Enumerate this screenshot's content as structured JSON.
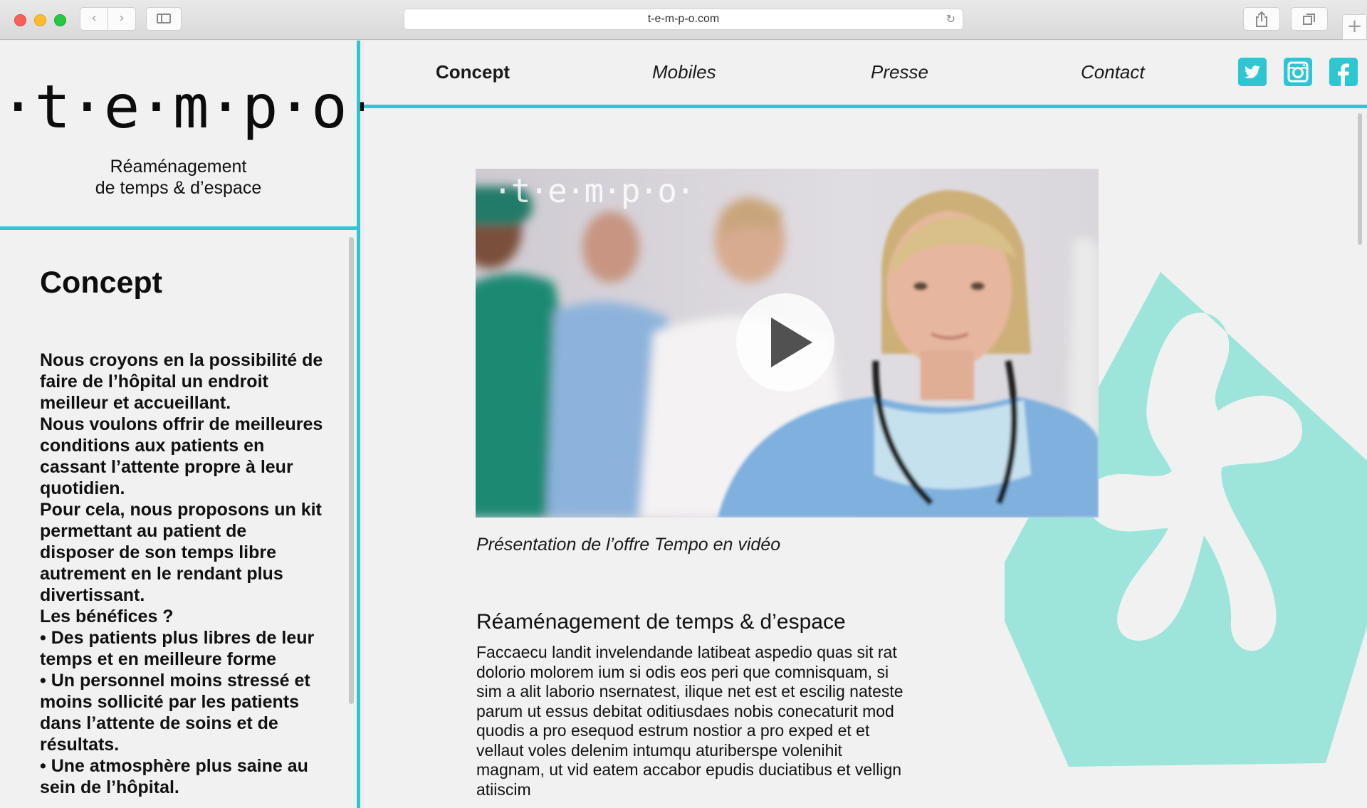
{
  "browser": {
    "url": "t-e-m-p-o.com",
    "back_icon": "‹",
    "forward_icon": "›",
    "reload_icon": "↻",
    "new_tab_icon": "+"
  },
  "sidebar": {
    "logo": "·t·e·m·p·o·",
    "tagline_line1": "Réaménagement",
    "tagline_line2": "de temps & d’espace",
    "title": "Concept",
    "paragraphs": [
      "Nous croyons en la possibilité de faire de l’hôpital un endroit meilleur et accueillant.",
      "Nous voulons offrir de meilleures conditions aux patients en cassant l’attente propre à leur quotidien.",
      "Pour cela, nous proposons un kit permettant au patient de disposer de son temps libre autrement en le rendant plus divertissant.",
      "Les bénéfices ?",
      "• Des patients plus libres de leur temps et en meilleure forme",
      "• Un personnel moins stressé et moins sollicité par les patients dans l’attente de soins et de résultats.",
      "• Une atmosphère plus saine au sein de l’hôpital."
    ]
  },
  "nav": {
    "items": [
      "Concept",
      "Mobiles",
      "Presse",
      "Contact"
    ],
    "active": "Concept",
    "social": [
      "twitter-icon",
      "instagram-icon",
      "facebook-icon"
    ]
  },
  "video": {
    "watermark": "·t·e·m·p·o·",
    "caption": "Présentation de l’offre Tempo en vidéo"
  },
  "content": {
    "heading": "Réaménagement de temps & d’espace",
    "body": "Faccaecu landit invelendande latibeat aspedio quas sit rat dolorio molorem ium si odis eos peri que comnisquam, si sim a alit laborio nsernatest, ilique net est et escilig nateste parum ut essus debitat oditiusdaes nobis conecaturit mod quodis a pro esequod estrum nostior a pro exped et et vellaut voles delenim intumqu aturiberspe volenihit magnam, ut vid eatem accabor epudis duciatibus et vellign atiiscim"
  },
  "colors": {
    "accent": "#2ec6d3",
    "shape": "#9de5da",
    "background": "#f1f1f1"
  }
}
